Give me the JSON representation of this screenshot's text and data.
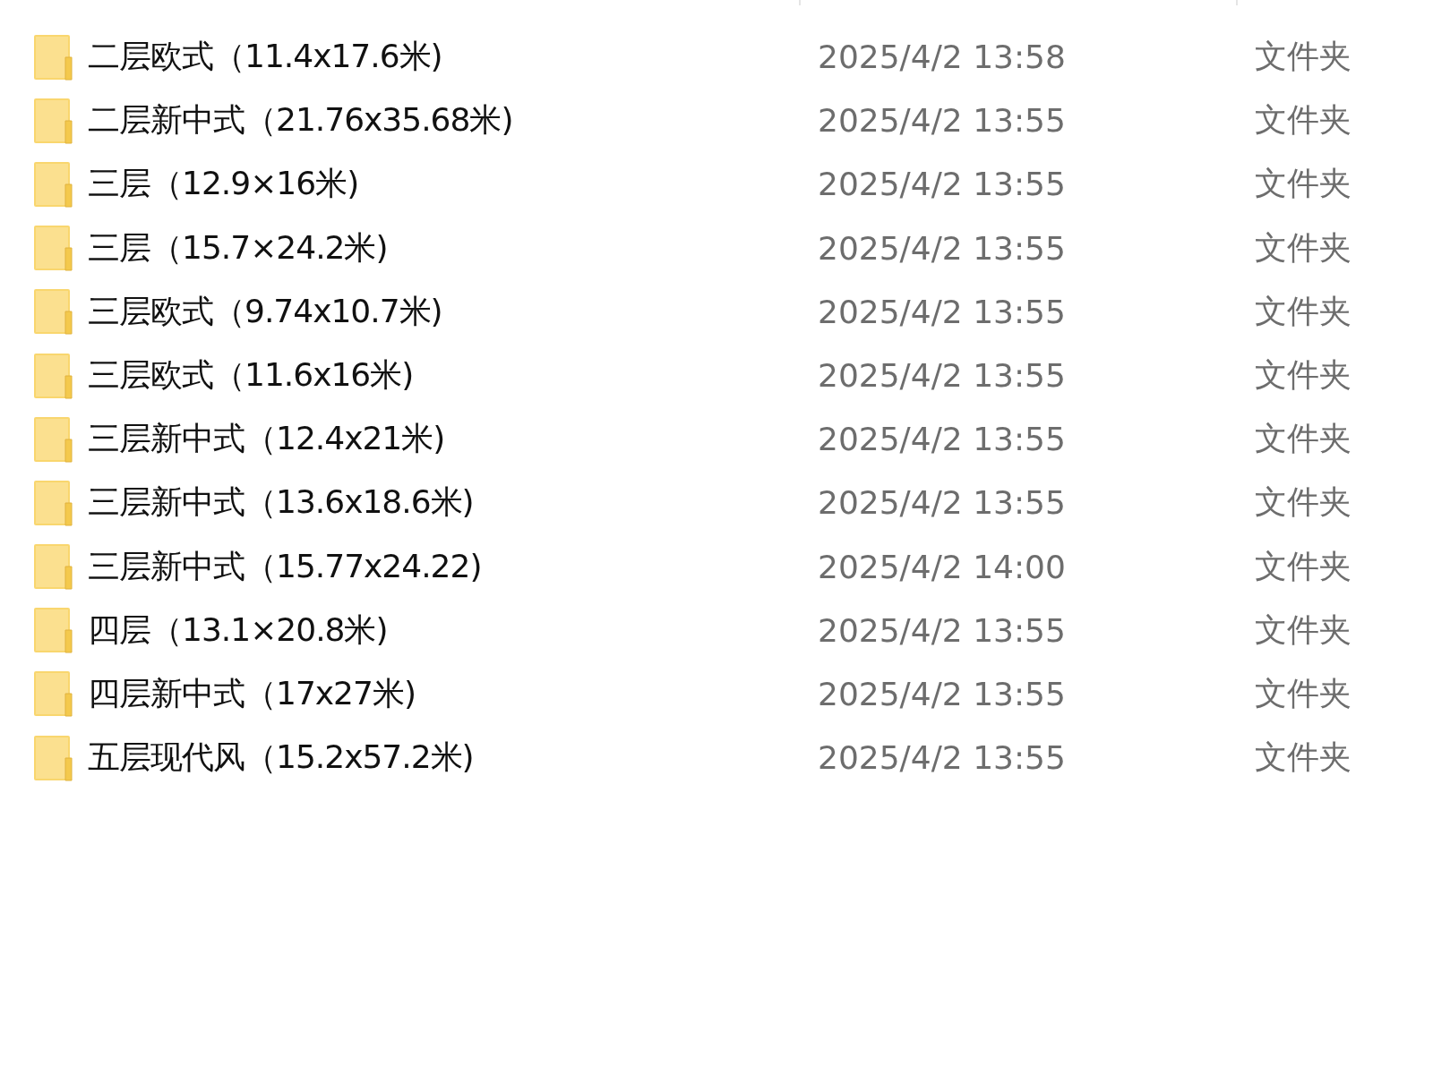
{
  "files": [
    {
      "name": "二层欧式（11.4x17.6米)",
      "date": "2025/4/2 13:58",
      "type": "文件夹"
    },
    {
      "name": "二层新中式（21.76x35.68米)",
      "date": "2025/4/2 13:55",
      "type": "文件夹"
    },
    {
      "name": "三层（12.9×16米)",
      "date": "2025/4/2 13:55",
      "type": "文件夹"
    },
    {
      "name": "三层（15.7×24.2米)",
      "date": "2025/4/2 13:55",
      "type": "文件夹"
    },
    {
      "name": "三层欧式（9.74x10.7米)",
      "date": "2025/4/2 13:55",
      "type": "文件夹"
    },
    {
      "name": "三层欧式（11.6x16米)",
      "date": "2025/4/2 13:55",
      "type": "文件夹"
    },
    {
      "name": "三层新中式（12.4x21米)",
      "date": "2025/4/2 13:55",
      "type": "文件夹"
    },
    {
      "name": "三层新中式（13.6x18.6米)",
      "date": "2025/4/2 13:55",
      "type": "文件夹"
    },
    {
      "name": "三层新中式（15.77x24.22)",
      "date": "2025/4/2 14:00",
      "type": "文件夹"
    },
    {
      "name": "四层（13.1×20.8米)",
      "date": "2025/4/2 13:55",
      "type": "文件夹"
    },
    {
      "name": "四层新中式（17x27米)",
      "date": "2025/4/2 13:55",
      "type": "文件夹"
    },
    {
      "name": "五层现代风（15.2x57.2米)",
      "date": "2025/4/2 13:55",
      "type": "文件夹"
    }
  ]
}
